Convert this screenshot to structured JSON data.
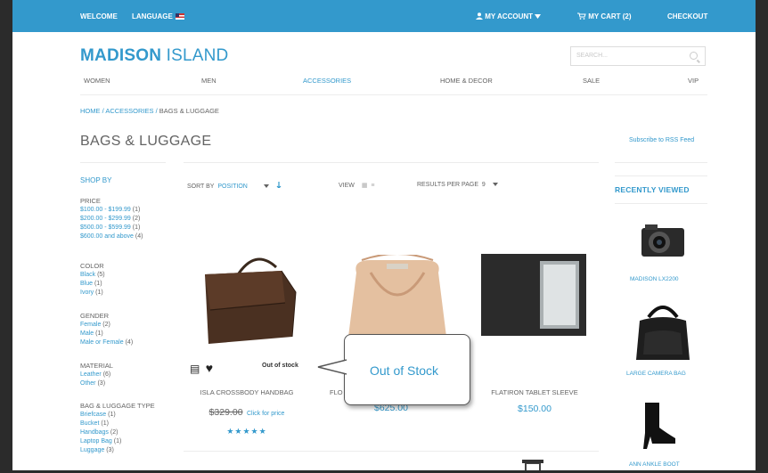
{
  "topbar": {
    "welcome": "WELCOME",
    "language": "LANGUAGE",
    "my_account": "MY ACCOUNT",
    "my_cart": "MY CART (2)",
    "checkout": "CHECKOUT"
  },
  "logo": {
    "bold": "MADISON",
    "light": "ISLAND"
  },
  "search": {
    "placeholder": "SEARCH..."
  },
  "nav": [
    "WOMEN",
    "MEN",
    "ACCESSORIES",
    "HOME & DECOR",
    "SALE",
    "VIP"
  ],
  "breadcrumb": {
    "home": "HOME",
    "sep1": " / ",
    "accessories": "ACCESSORIES",
    "sep2": " / ",
    "current": "BAGS & LUGGAGE"
  },
  "page_title": "BAGS & LUGGAGE",
  "rss": "Subscribe to RSS Feed",
  "sidebar": {
    "shop_by": "SHOP BY",
    "price": {
      "title": "PRICE",
      "items": [
        {
          "label": "$100.00 - $199.99",
          "count": "(1)"
        },
        {
          "label": "$200.00 - $299.99",
          "count": "(2)"
        },
        {
          "label": "$500.00 - $599.99",
          "count": "(1)"
        },
        {
          "label": "$600.00 and above",
          "count": "(4)"
        }
      ]
    },
    "color": {
      "title": "COLOR",
      "items": [
        {
          "label": "Black",
          "count": "(5)"
        },
        {
          "label": "Blue",
          "count": "(1)"
        },
        {
          "label": "Ivory",
          "count": "(1)"
        }
      ]
    },
    "gender": {
      "title": "GENDER",
      "items": [
        {
          "label": "Female",
          "count": "(2)"
        },
        {
          "label": "Male",
          "count": "(1)"
        },
        {
          "label": "Male or Female",
          "count": "(4)"
        }
      ]
    },
    "material": {
      "title": "MATERIAL",
      "items": [
        {
          "label": "Leather",
          "count": "(6)"
        },
        {
          "label": "Other",
          "count": "(3)"
        }
      ]
    },
    "type": {
      "title": "BAG & LUGGAGE TYPE",
      "items": [
        {
          "label": "Briefcase",
          "count": "(1)"
        },
        {
          "label": "Bucket",
          "count": "(1)"
        },
        {
          "label": "Handbags",
          "count": "(2)"
        },
        {
          "label": "Laptop Bag",
          "count": "(1)"
        },
        {
          "label": "Luggage",
          "count": "(3)"
        }
      ]
    }
  },
  "toolbar": {
    "sort_label": "SORT BY",
    "sort_value": "POSITION",
    "view_label": "VIEW",
    "per_page_label": "RESULTS PER PAGE",
    "per_page_value": "9"
  },
  "products": [
    {
      "name": "ISLA CROSSBODY HANDBAG",
      "old_price": "$329.00",
      "click_for_price": "Click for price",
      "rating": 4
    },
    {
      "name": "FLO",
      "price": "$625.00"
    },
    {
      "name": "FLATIRON TABLET SLEEVE",
      "price": "$150.00"
    }
  ],
  "out_of_stock": "Out of stock",
  "callout": "Out of Stock",
  "recently_viewed": {
    "title": "RECENTLY VIEWED",
    "items": [
      "MADISON LX2200",
      "LARGE CAMERA BAG",
      "ANN ANKLE BOOT"
    ]
  },
  "colors": {
    "accent": "#3399cc",
    "topbar": "#3399cc",
    "text": "#636363"
  }
}
